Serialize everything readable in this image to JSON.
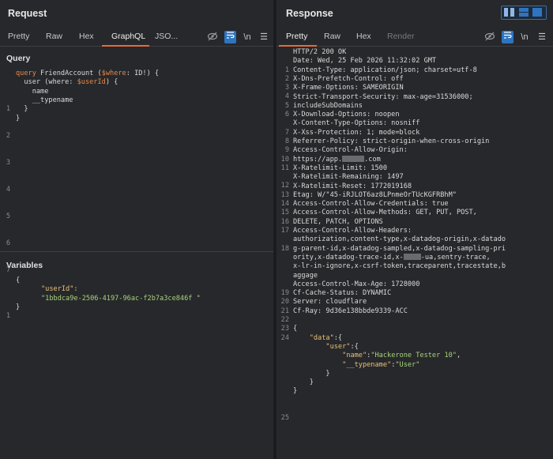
{
  "request": {
    "title": "Request",
    "tabs": [
      "Pretty",
      "Raw",
      "Hex",
      "GraphQL",
      "JSO..."
    ],
    "active_tab": "GraphQL",
    "newline_label": "\\n",
    "query_section": "Query",
    "query_line_numbers": [
      "1",
      "2",
      "3",
      "4",
      "5",
      "6",
      "7"
    ],
    "query_lines": [
      {
        "k": "query",
        "r": " FriendAccount (",
        "v": "$where",
        "r2": ": ID!) {"
      },
      {
        "t": "  user (where: ",
        "v": "$userId",
        "r2": ") {"
      },
      {
        "t": "    name"
      },
      {
        "t": "    __typename"
      },
      {
        "t": "  }"
      },
      {
        "t": "}"
      },
      {
        "t": ""
      }
    ],
    "variables_section": "Variables",
    "var_line_numbers": [
      "1",
      "",
      ""
    ],
    "var_brace_open": "{",
    "var_key": "\"userId\":",
    "var_value": "\"1bbdca9e-2506-4197-96ac-f2b7a3ce846f \"",
    "var_brace_close": "}"
  },
  "response": {
    "title": "Response",
    "tabs": [
      "Pretty",
      "Raw",
      "Hex",
      "Render"
    ],
    "active_tab": "Pretty",
    "newline_label": "\\n",
    "line_numbers": [
      "1",
      "2",
      "3",
      "4",
      "5",
      "6",
      "",
      "7",
      "8",
      "9",
      "10",
      "11",
      "",
      "12",
      "13",
      "14",
      "15",
      "16",
      "17",
      "",
      "18",
      "",
      "",
      "",
      "",
      "19",
      "20",
      "21",
      "22",
      "23",
      "24",
      "",
      "",
      "",
      "",
      "",
      "",
      "",
      "",
      "25"
    ],
    "lines": [
      "HTTP/2 200 OK",
      "Date: Wed, 25 Feb 2026 11:32:02 GMT",
      "Content-Type: application/json; charset=utf-8",
      "X-Dns-Prefetch-Control: off",
      "X-Frame-Options: SAMEORIGIN",
      "Strict-Transport-Security: max-age=31536000;",
      "includeSubDomains",
      "X-Download-Options: noopen",
      "X-Content-Type-Options: nosniff",
      "X-Xss-Protection: 1; mode=block",
      "Referrer-Policy: strict-origin-when-cross-origin",
      "Access-Control-Allow-Origin:",
      "https://app.",
      "X-Ratelimit-Limit: 1500",
      "X-Ratelimit-Remaining: 1497",
      "X-Ratelimit-Reset: 1772019168",
      "Etag: W/\"45-iRJLOT6az8LPnmeOrTUcKGFRBhM\"",
      "Access-Control-Allow-Credentials: true",
      "Access-Control-Allow-Methods: GET, PUT, POST,",
      "DELETE, PATCH, OPTIONS",
      "Access-Control-Allow-Headers:",
      "authorization,content-type,x-datadog-origin,x-datado",
      "g-parent-id,x-datadog-sampled,x-datadog-sampling-pri",
      "ority,x-datadog-trace-id,x-",
      "x-lr-in-ignore,x-csrf-token,traceparent,tracestate,b",
      "aggage",
      "Access-Control-Max-Age: 1728000",
      "Cf-Cache-Status: DYNAMIC",
      "Server: cloudflare",
      "Cf-Ray: 9d36e138bbde9339-ACC",
      "",
      "{",
      "    \"data\":{",
      "        \"user\":{",
      "            \"name\":\"Hackerone Tester 10\",",
      "            \"__typename\":\"User\"",
      "        }",
      "    }",
      "}",
      ""
    ],
    "origin_tail": ".com",
    "headers_tail": "-ua,sentry-trace,",
    "json_data_key": "\"data\"",
    "json_user_key": "\"user\"",
    "json_name_key": "\"name\"",
    "json_name_val": "\"Hackerone Tester 10\"",
    "json_type_key": "\"__typename\"",
    "json_type_val": "\"User\""
  },
  "colors": {
    "accent": "#e8693a",
    "keyword": "#e8884a",
    "string": "#a9d37a",
    "key": "#e6c07b",
    "button": "#2f74c0"
  }
}
